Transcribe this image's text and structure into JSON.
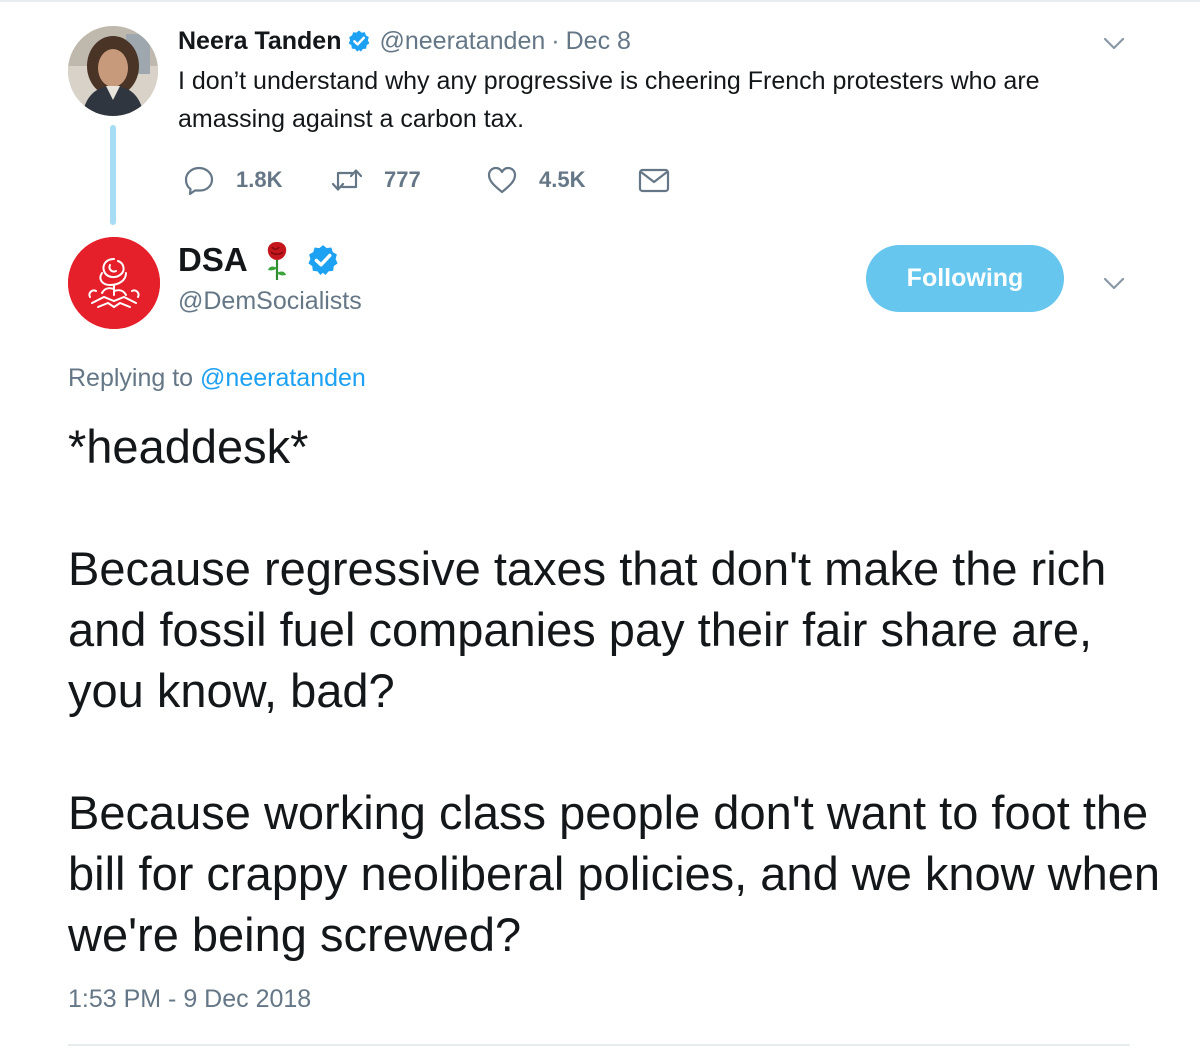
{
  "parent_tweet": {
    "author_name": "Neera Tanden",
    "handle": "@neeratanden",
    "separator": "·",
    "date": "Dec 8",
    "text": "I don’t understand why any progressive is cheering French protesters who are amassing against a carbon tax.",
    "actions": {
      "replies": "1.8K",
      "retweets": "777",
      "likes": "4.5K"
    },
    "avatar_icon": "user-photo-avatar",
    "verified_icon": "verified-badge-icon"
  },
  "main_tweet": {
    "author_name": "DSA",
    "handle": "@DemSocialists",
    "follow_label": "Following",
    "replying_prefix": "Replying to ",
    "replying_mention": "@neeratanden",
    "paragraphs": [
      "*headdesk*",
      "Because regressive taxes that don't make the rich and fossil fuel companies pay their fair share are, you know, bad?",
      "Because working class people don't want to foot the bill for crappy neoliberal policies, and we know when we're being screwed?"
    ],
    "timestamp": "1:53 PM - 9 Dec 2018",
    "avatar_icon": "dsa-rose-logo",
    "name_emoji": "rose-icon"
  },
  "colors": {
    "text_primary": "#14171a",
    "text_secondary": "#657786",
    "link_blue": "#1da1f2",
    "follow_button": "#66c6ee",
    "thread_line": "#a7dcf5",
    "dsa_red": "#e5202a",
    "divider": "#e6ecf0"
  }
}
